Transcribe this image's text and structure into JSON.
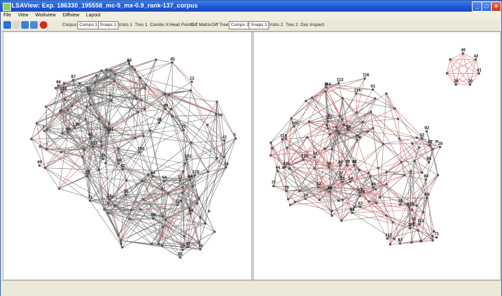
{
  "window": {
    "title": "LSAView: Exp. 186330_195558_mc-5_mx-0.9_rank-137_corpus",
    "minimize_glyph": "_",
    "maximize_glyph": "□",
    "close_glyph": "×"
  },
  "menu": [
    "File",
    "View",
    "Workview",
    "Diffview",
    "Layout"
  ],
  "toolbar": {
    "icons": [
      "open-folder-icon",
      "new-icon",
      "save-icon",
      "print-icon",
      "power-icon"
    ],
    "icon_colors": [
      "#2d6fd6",
      "#d8d8d8",
      "#3a7fd6",
      "#4a8ad8",
      "#d32b1e"
    ],
    "buttons": [
      {
        "label": "Corpus",
        "pressed": false
      },
      {
        "label": "Compo 1",
        "pressed": true
      },
      {
        "label": "Snaps 1",
        "pressed": true
      },
      {
        "label": "Vstrs 1",
        "pressed": false
      },
      {
        "label": "Tres 1",
        "pressed": false
      },
      {
        "label": "Combo X",
        "pressed": false
      },
      {
        "label": "Head Points",
        "pressed": false
      },
      {
        "label": "Diff Matrix",
        "pressed": false
      },
      {
        "label": "Diff Tree",
        "pressed": false
      },
      {
        "label": "Compo 2",
        "pressed": true
      },
      {
        "label": "Snaps 2",
        "pressed": true
      },
      {
        "label": "Vstrs 2",
        "pressed": false
      },
      {
        "label": "Tres 2",
        "pressed": false
      },
      {
        "label": "Doc Inspect",
        "pressed": false
      }
    ]
  },
  "graph_colors": {
    "edge_gray": "#777777",
    "edge_red": "#d26a6a",
    "node": "#555555"
  },
  "left_graph": {
    "node_labels": [
      "96",
      "76",
      "123",
      "32",
      "129",
      "118",
      "55",
      "59",
      "61",
      "54",
      "11",
      "87",
      "71",
      "100",
      "7",
      "99",
      "130",
      "12",
      "63",
      "49",
      "45",
      "75",
      "23",
      "102",
      "80",
      "127",
      "38",
      "58",
      "41",
      "47",
      "121",
      "5",
      "18",
      "27",
      "69",
      "24",
      "62",
      "31",
      "9",
      "64",
      "44",
      "66"
    ]
  },
  "right_graph": {
    "node_labels": [
      "40",
      "42",
      "41",
      "36",
      "39",
      "32",
      "100",
      "78",
      "29",
      "86",
      "54",
      "88",
      "59",
      "80",
      "92",
      "77",
      "13",
      "35",
      "34",
      "108",
      "30",
      "37",
      "67",
      "43",
      "129",
      "128",
      "95",
      "84",
      "118",
      "75",
      "46",
      "65",
      "80",
      "87",
      "71",
      "55",
      "112",
      "117",
      "109",
      "107",
      "61",
      "114",
      "113",
      "116",
      "114",
      "6",
      "22",
      "21",
      "52",
      "44",
      "50",
      "48"
    ]
  }
}
